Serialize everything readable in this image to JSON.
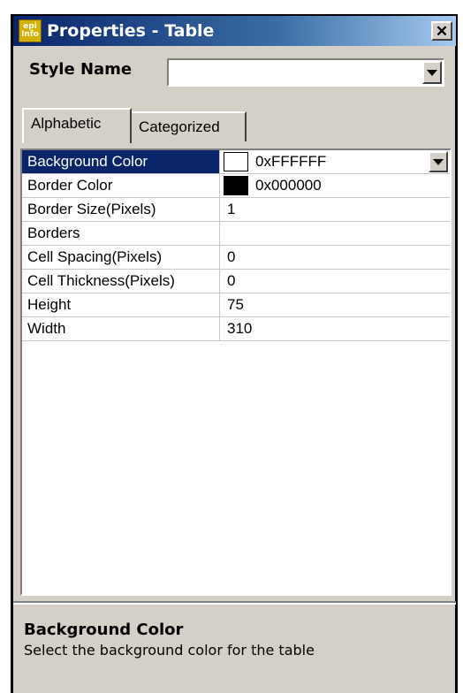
{
  "window": {
    "title": "Properties - Table",
    "icon_text_top": "epi",
    "icon_text_bottom": "Info",
    "close_glyph": "✕"
  },
  "style": {
    "label": "Style Name",
    "value": ""
  },
  "tabs": [
    {
      "label": "Alphabetic",
      "active": true
    },
    {
      "label": "Categorized",
      "active": false
    }
  ],
  "properties": [
    {
      "name": "Background Color",
      "value": "0xFFFFFF",
      "swatch": "#ffffff",
      "selected": true
    },
    {
      "name": "Border Color",
      "value": "0x000000",
      "swatch": "#000000"
    },
    {
      "name": "Border Size(Pixels)",
      "value": "1"
    },
    {
      "name": "Borders",
      "value": ""
    },
    {
      "name": "Cell Spacing(Pixels)",
      "value": "0"
    },
    {
      "name": "Cell Thickness(Pixels)",
      "value": "0"
    },
    {
      "name": "Height",
      "value": "75"
    },
    {
      "name": "Width",
      "value": "310"
    }
  ],
  "description": {
    "title": "Background Color",
    "text": "Select the background color for the table"
  },
  "colors": {
    "selection": "#0a246a",
    "face": "#d4d0c8"
  }
}
